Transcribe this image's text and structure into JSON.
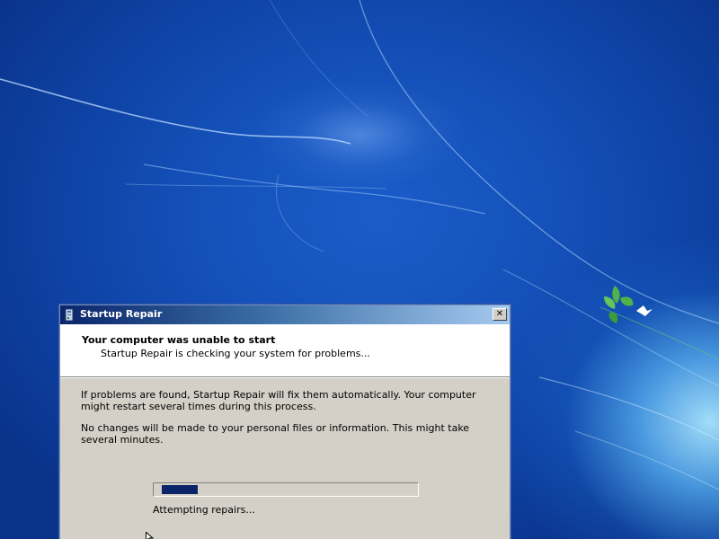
{
  "dialog": {
    "title": "Startup Repair",
    "header_title": "Your computer was unable to start",
    "header_subtitle": "Startup Repair is checking your system for problems...",
    "paragraph1": "If problems are found, Startup Repair will fix them automatically. Your computer might restart several times during this process.",
    "paragraph2": "No changes will be made to your personal files or information. This might take several minutes.",
    "status": "Attempting repairs...",
    "close_label": "✕"
  },
  "progress": {
    "type": "marquee"
  },
  "colors": {
    "title_bar_start": "#0a246a",
    "title_bar_end": "#a6caf0",
    "dialog_face": "#d4d0c8",
    "progress_chunk": "#0a246a",
    "desktop_blue": "#1450b8"
  },
  "icons": {
    "title": "startup-repair-icon",
    "close": "close-icon"
  }
}
